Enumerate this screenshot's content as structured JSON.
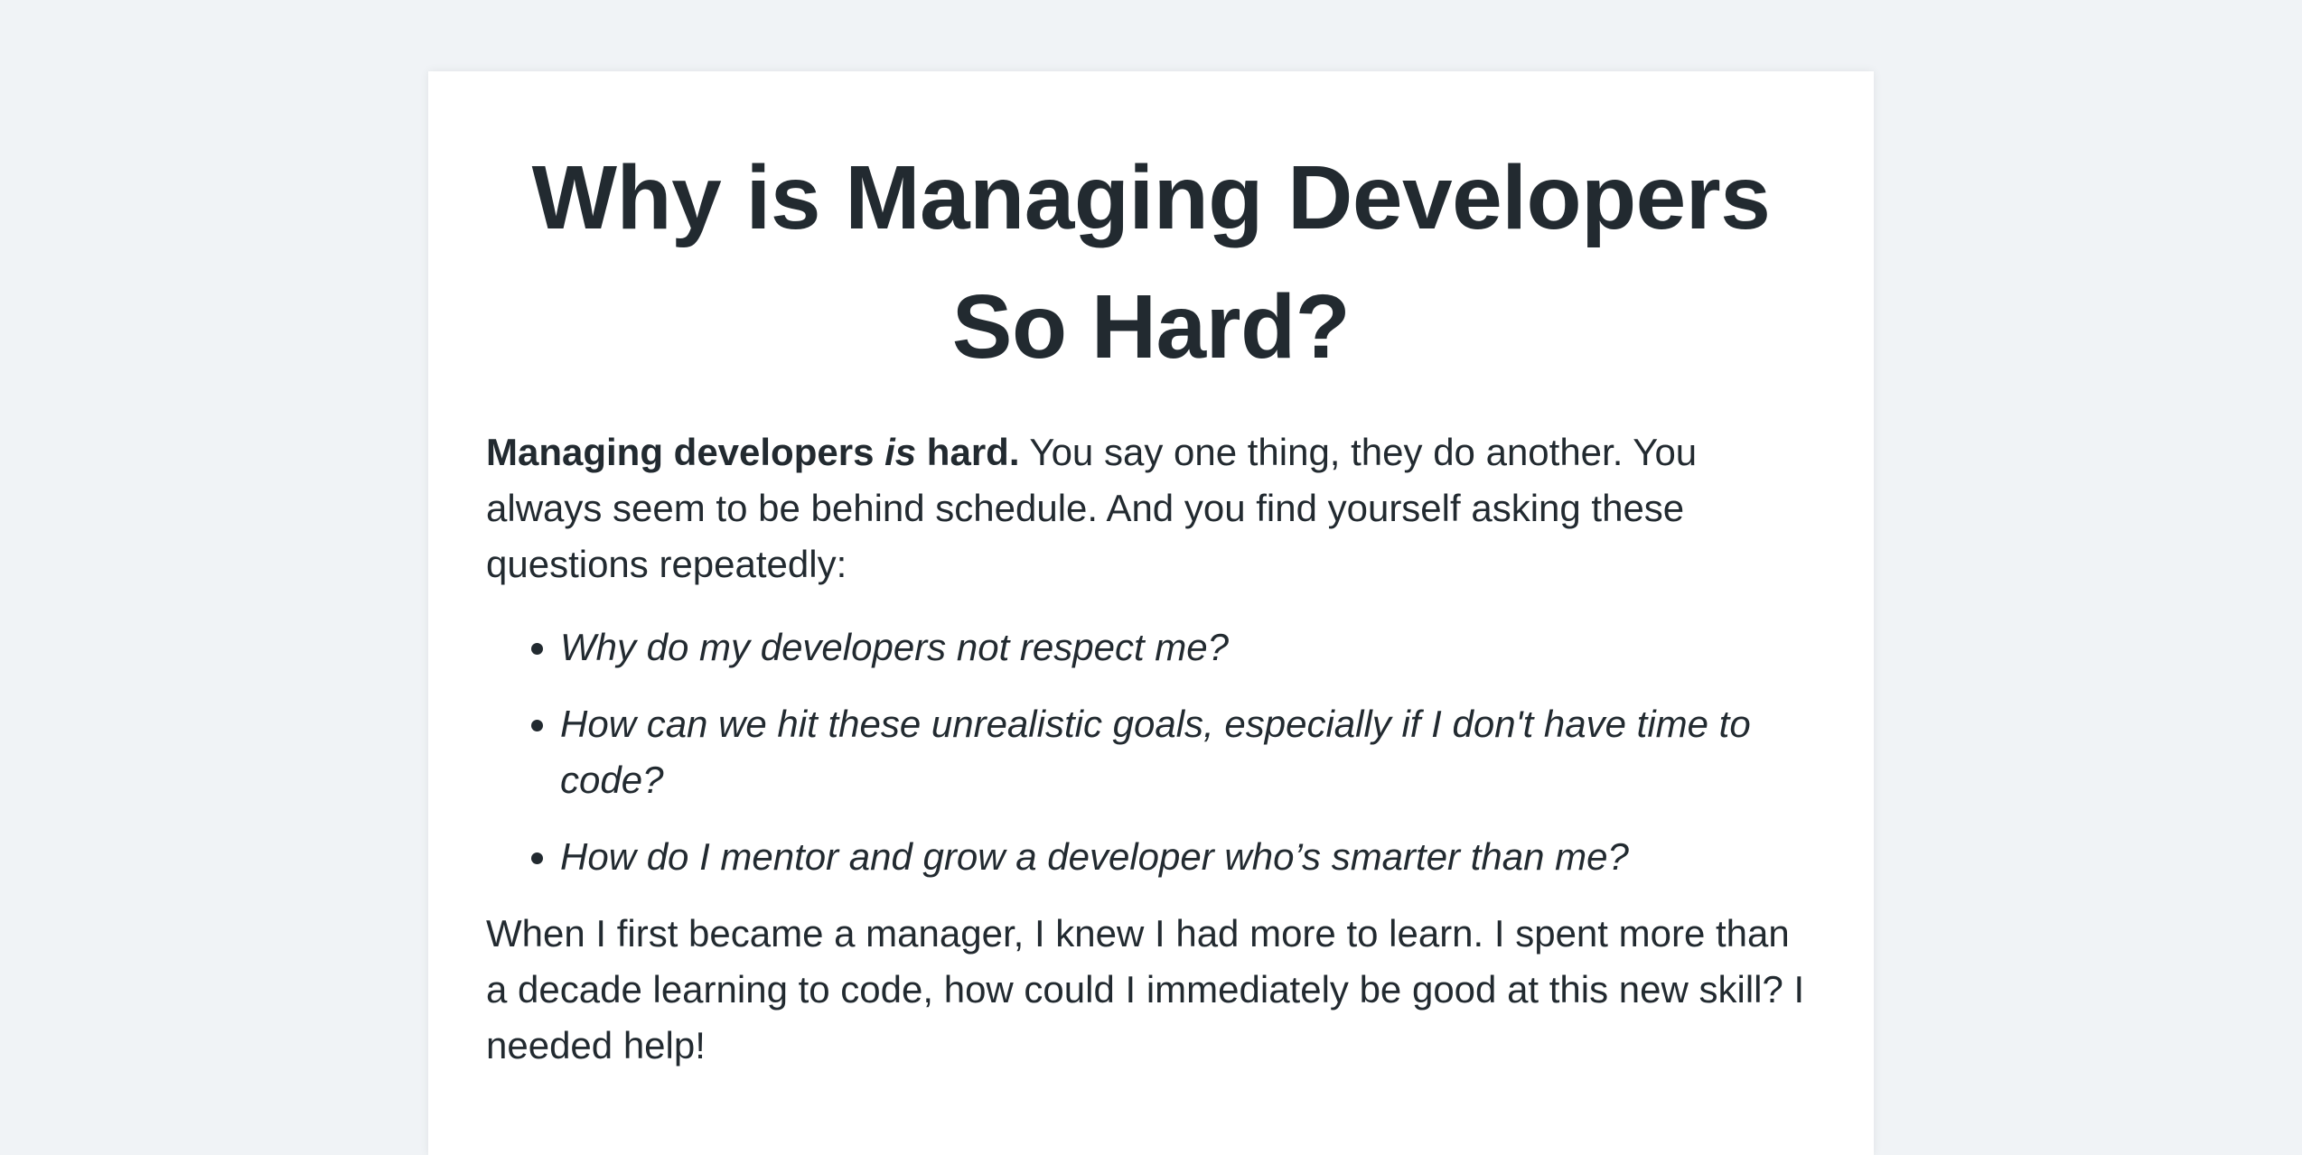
{
  "article": {
    "title_line1": "Why is Managing Developers",
    "title_line2": "So Hard?",
    "intro": {
      "bold_start": "Managing developers ",
      "bold_emphasis": "is",
      "bold_end": " hard.",
      "rest": " You say one thing, they do another. You always seem to be behind schedule. And you find yourself asking these questions repeatedly:"
    },
    "questions": [
      "Why do my developers not respect me?",
      "How can we hit these unrealistic goals, especially if I don't have time to code?",
      "How do I mentor and grow a developer who’s smarter than me?"
    ],
    "closing": "When I first became a manager, I knew I had more to learn. I spent more than a decade learning to code, how could I immediately be good at this new skill? I needed help!"
  }
}
